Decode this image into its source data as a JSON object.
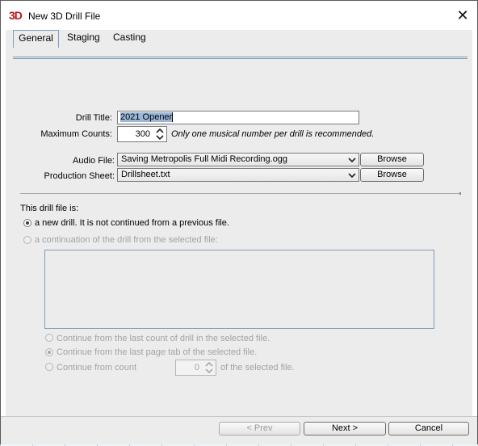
{
  "window": {
    "app_icon_text": "3D",
    "title": "New 3D Drill File",
    "close_glyph": "✕"
  },
  "tabs": [
    {
      "label": "General",
      "active": true
    },
    {
      "label": "Staging",
      "active": false
    },
    {
      "label": "Casting",
      "active": false
    }
  ],
  "form": {
    "drill_title_label": "Drill Title:",
    "drill_title_value": "2021 Opener",
    "max_counts_label": "Maximum Counts:",
    "max_counts_value": "300",
    "max_counts_note": "Only one musical number per drill is recommended.",
    "audio_file_label": "Audio File:",
    "audio_file_value": "Saving Metropolis Full Midi Recording.ogg",
    "production_sheet_label": "Production Sheet:",
    "production_sheet_value": "Drillsheet.txt",
    "browse_label": "Browse"
  },
  "drill_source": {
    "heading": "This drill file is:",
    "option_new": "a new drill.  It is not continued from a previous file.",
    "option_continuation": "a continuation of the drill from the selected file:",
    "selected": "new"
  },
  "continue_options": {
    "last_count": "Continue from the last count of drill in the selected file.",
    "last_page_tab": "Continue from the last page tab of the selected file.",
    "from_count": "Continue from count",
    "from_count_value": "0",
    "from_count_suffix": "of the selected file.",
    "selected": "last_page_tab"
  },
  "buttons": {
    "prev": "< Prev",
    "next": "Next >",
    "cancel": "Cancel"
  },
  "colors": {
    "app_icon": "#b7181e",
    "tab_border": "#7f9db9",
    "selection": "#9bb7d8"
  }
}
